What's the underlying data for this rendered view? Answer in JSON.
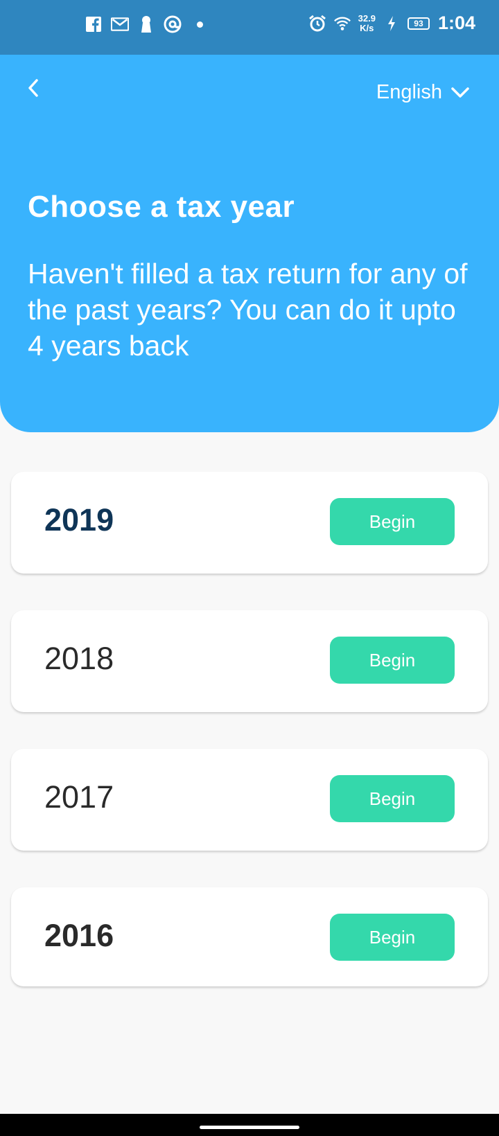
{
  "status_bar": {
    "time": "1:04",
    "net_speed_value": "32.9",
    "net_speed_unit": "K/s",
    "battery_level": "93",
    "left_icons": [
      "facebook-icon",
      "gmail-icon",
      "keyhole-icon",
      "at-sign-icon",
      "notification-dot-icon"
    ],
    "right_icons": [
      "alarm-icon",
      "wifi-icon",
      "charging-bolt-icon",
      "battery-icon"
    ]
  },
  "header": {
    "back_icon": "chevron-left-icon",
    "language": "English",
    "language_icon": "chevron-down-icon",
    "title": "Choose a tax year",
    "subtitle": "Haven't filled a tax return for any of the past years? You can do it upto 4 years back",
    "background_color": "#39b3fd"
  },
  "years": [
    {
      "year": "2019",
      "action": "Begin"
    },
    {
      "year": "2018",
      "action": "Begin"
    },
    {
      "year": "2017",
      "action": "Begin"
    },
    {
      "year": "2016",
      "action": "Begin"
    }
  ],
  "colors": {
    "status_bar": "#2f86bf",
    "accent_button": "#34d8ab",
    "year_highlight": "#0f3557"
  }
}
